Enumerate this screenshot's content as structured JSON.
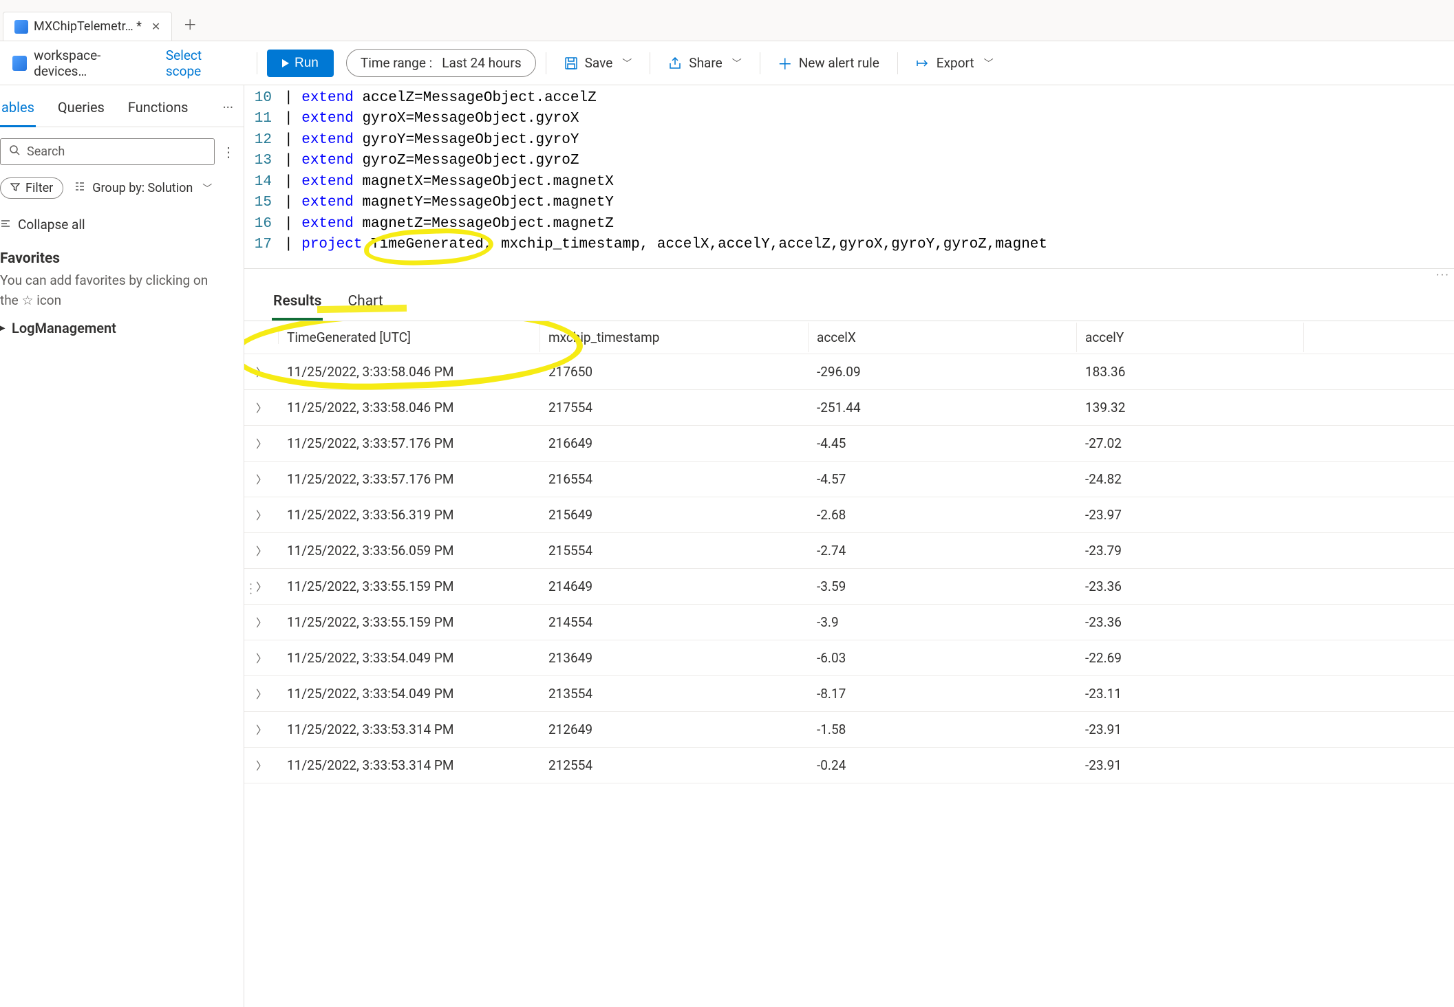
{
  "tab": {
    "title": "MXChipTelemetr… *"
  },
  "toolbar": {
    "scope_label": "workspace-devices…",
    "select_scope": "Select scope",
    "run": "Run",
    "time_range_label": "Time range :",
    "time_range_value": "Last 24 hours",
    "save": "Save",
    "share": "Share",
    "new_alert": "New alert rule",
    "export": "Export"
  },
  "sidebar": {
    "tabs": {
      "tables": "ables",
      "queries": "Queries",
      "functions": "Functions"
    },
    "search_placeholder": "Search",
    "filter": "Filter",
    "group_by": "Group by: Solution",
    "collapse_all": "Collapse all",
    "favorites_title": "Favorites",
    "favorites_hint_a": "You can add favorites by clicking on",
    "favorites_hint_b": "the ",
    "favorites_hint_c": " icon",
    "tree_item": "LogManagement"
  },
  "editor": {
    "lines": [
      {
        "n": "10",
        "pipe": "| ",
        "kw": "extend ",
        "rest": "accelZ=MessageObject.accelZ"
      },
      {
        "n": "11",
        "pipe": "| ",
        "kw": "extend ",
        "rest": "gyroX=MessageObject.gyroX"
      },
      {
        "n": "12",
        "pipe": "| ",
        "kw": "extend ",
        "rest": "gyroY=MessageObject.gyroY"
      },
      {
        "n": "13",
        "pipe": "| ",
        "kw": "extend ",
        "rest": "gyroZ=MessageObject.gyroZ"
      },
      {
        "n": "14",
        "pipe": "| ",
        "kw": "extend ",
        "rest": "magnetX=MessageObject.magnetX"
      },
      {
        "n": "15",
        "pipe": "| ",
        "kw": "extend ",
        "rest": "magnetY=MessageObject.magnetY"
      },
      {
        "n": "16",
        "pipe": "| ",
        "kw": "extend ",
        "rest": "magnetZ=MessageObject.magnetZ"
      }
    ],
    "project_line_n": "17",
    "project_pipe": "| ",
    "project_kw": "project ",
    "project_highlight": "TimeGenerated",
    "project_rest": ", mxchip_timestamp, accelX,accelY,accelZ,gyroX,gyroY,gyroZ,magnet"
  },
  "results": {
    "tabs": {
      "results": "Results",
      "chart": "Chart"
    },
    "columns": [
      "TimeGenerated [UTC]",
      "mxchip_timestamp",
      "accelX",
      "accelY"
    ],
    "rows": [
      {
        "t": "11/25/2022, 3:33:58.046 PM",
        "ts": "217650",
        "ax": "-296.09",
        "ay": "183.36"
      },
      {
        "t": "11/25/2022, 3:33:58.046 PM",
        "ts": "217554",
        "ax": "-251.44",
        "ay": "139.32"
      },
      {
        "t": "11/25/2022, 3:33:57.176 PM",
        "ts": "216649",
        "ax": "-4.45",
        "ay": "-27.02"
      },
      {
        "t": "11/25/2022, 3:33:57.176 PM",
        "ts": "216554",
        "ax": "-4.57",
        "ay": "-24.82"
      },
      {
        "t": "11/25/2022, 3:33:56.319 PM",
        "ts": "215649",
        "ax": "-2.68",
        "ay": "-23.97"
      },
      {
        "t": "11/25/2022, 3:33:56.059 PM",
        "ts": "215554",
        "ax": "-2.74",
        "ay": "-23.79"
      },
      {
        "t": "11/25/2022, 3:33:55.159 PM",
        "ts": "214649",
        "ax": "-3.59",
        "ay": "-23.36"
      },
      {
        "t": "11/25/2022, 3:33:55.159 PM",
        "ts": "214554",
        "ax": "-3.9",
        "ay": "-23.36"
      },
      {
        "t": "11/25/2022, 3:33:54.049 PM",
        "ts": "213649",
        "ax": "-6.03",
        "ay": "-22.69"
      },
      {
        "t": "11/25/2022, 3:33:54.049 PM",
        "ts": "213554",
        "ax": "-8.17",
        "ay": "-23.11"
      },
      {
        "t": "11/25/2022, 3:33:53.314 PM",
        "ts": "212649",
        "ax": "-1.58",
        "ay": "-23.91"
      },
      {
        "t": "11/25/2022, 3:33:53.314 PM",
        "ts": "212554",
        "ax": "-0.24",
        "ay": "-23.91"
      }
    ]
  }
}
